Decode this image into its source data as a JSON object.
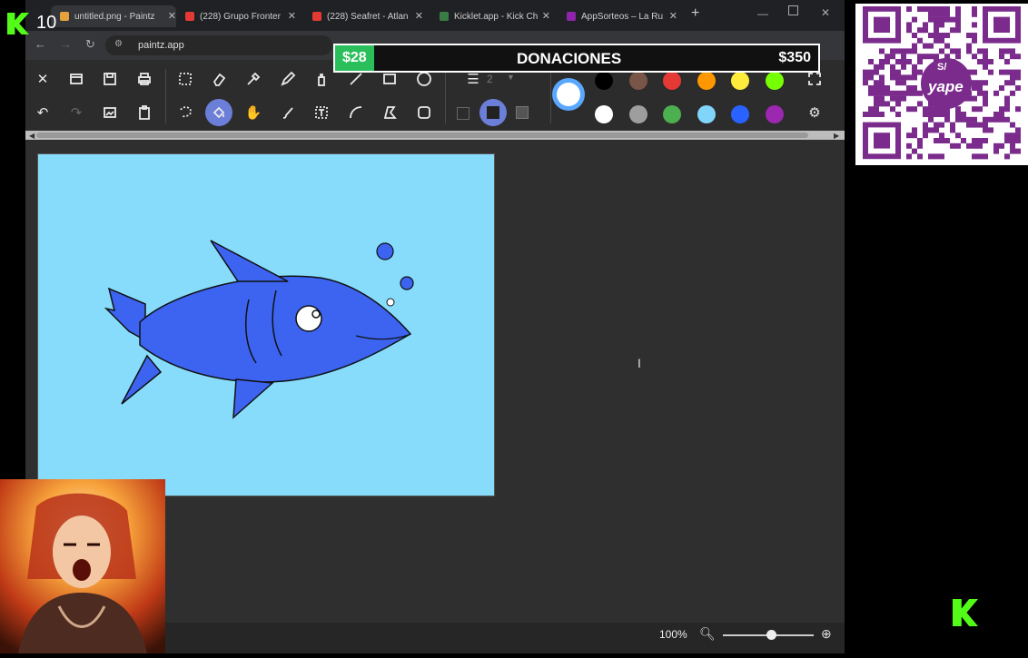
{
  "overlay": {
    "stream_counter": "10",
    "donation": {
      "current": "$28",
      "label": "DONACIONES",
      "goal": "$350",
      "progress": 0.08
    },
    "qr_brand": "yape",
    "qr_currency": "S/"
  },
  "browser": {
    "tabs": [
      {
        "label": "untitled.png - Paintz",
        "active": true
      },
      {
        "label": "(228) Grupo Fronter"
      },
      {
        "label": "(228) Seafret - Atlan"
      },
      {
        "label": "Kicklet.app - Kick Ch"
      },
      {
        "label": "AppSorteos – La Ru"
      }
    ],
    "new_tab": "+",
    "url": "paintz.app"
  },
  "palette": {
    "primary_color": "#ffffff",
    "colors_row1": [
      "#000000",
      "#795548",
      "#e53935",
      "#ff9800",
      "#ffeb3b",
      "#76ff03"
    ],
    "colors_row2": [
      "#ffffff",
      "#9e9e9e",
      "#4caf50",
      "#81d4fa",
      "#2962ff",
      "#9c27b0"
    ]
  },
  "toolbar": {
    "line_width": "2"
  },
  "status": {
    "zoom": "100%",
    "zoom_level": 1.0
  },
  "colors": {
    "canvas_bg": "#87dcfc",
    "fish": "#3c64f0",
    "donation_accent": "#2bbf5c",
    "kick_green": "#53fc18"
  }
}
